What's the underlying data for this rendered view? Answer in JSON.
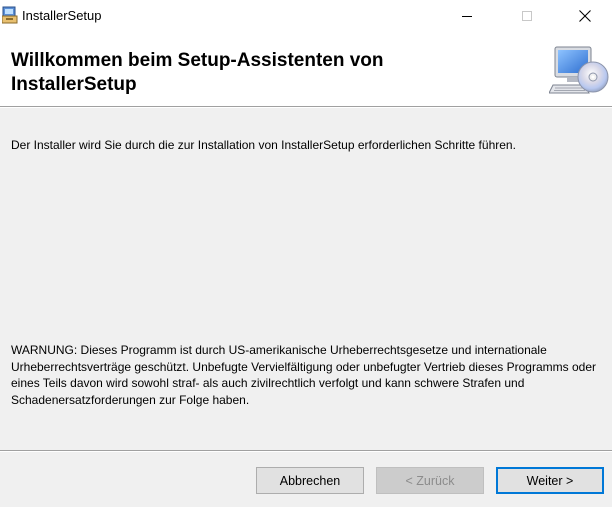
{
  "window": {
    "title": "InstallerSetup",
    "controls": {
      "minimize": "minimize-icon",
      "maximize": "maximize-icon",
      "close": "close-icon"
    }
  },
  "header": {
    "title": "Willkommen beim Setup-Assistenten von InstallerSetup",
    "image": "computer-cd-icon"
  },
  "body": {
    "intro": "Der Installer wird Sie durch die zur Installation von InstallerSetup erforderlichen Schritte führen.",
    "warning": "WARNUNG: Dieses Programm ist durch US-amerikanische Urheberrechtsgesetze und internationale Urheberrechtsverträge geschützt. Unbefugte Vervielfältigung oder unbefugter Vertrieb dieses Programms oder eines Teils davon wird sowohl straf- als auch zivilrechtlich verfolgt und kann schwere Strafen und Schadenersatzforderungen zur Folge haben."
  },
  "buttons": {
    "cancel": "Abbrechen",
    "back": "< Zurück",
    "next": "Weiter >"
  },
  "colors": {
    "dialog_background": "#f0f0f0",
    "header_background": "#ffffff",
    "default_button_border": "#0078d7"
  }
}
